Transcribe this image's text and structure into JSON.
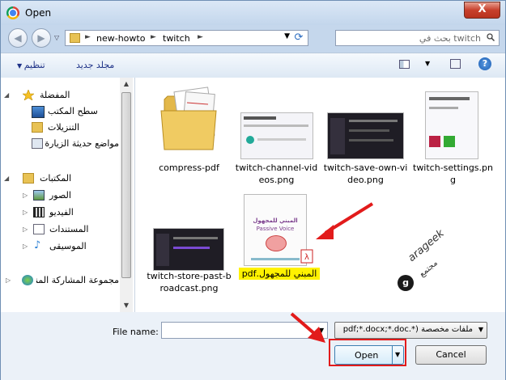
{
  "window": {
    "title": "Open",
    "close_glyph": "X"
  },
  "address": {
    "crumbs": [
      "new-howto",
      "twitch"
    ],
    "sep_glyph": "►",
    "search_placeholder": "twitch بحث في"
  },
  "toolbar": {
    "organize_label": "تنظيم",
    "new_folder_label": "مجلد جديد"
  },
  "sidebar": {
    "favorites_header": "المفضلة",
    "favorites": [
      "سطح المكتب",
      "التنزيلات",
      "مواضع حديثة الزيارة"
    ],
    "libraries_header": "المكتبات",
    "libraries": [
      "الصور",
      "الفيديو",
      "المستندات",
      "الموسيقى"
    ],
    "homegroup": "مجموعة المشاركة المنزلية"
  },
  "files": [
    {
      "name": "compress-pdf",
      "kind": "folder"
    },
    {
      "name": "twitch-channel-videos.png",
      "kind": "png-light"
    },
    {
      "name": "twitch-save-own-video.png",
      "kind": "png-dark"
    },
    {
      "name": "twitch-settings.png",
      "kind": "png-light-tall"
    },
    {
      "name": "twitch-store-past-broadcast.png",
      "kind": "png-dark"
    },
    {
      "name": "المبني للمجهول.pdf",
      "kind": "pdf",
      "selected": true
    }
  ],
  "pdf_cover": {
    "title": "المبني للمجهول",
    "subtitle": "Passive Voice"
  },
  "footer": {
    "filename_label": "File name:",
    "filename_value": "",
    "type_value": "ملفات مخصصة (*.pdf;*.docx;*.doc",
    "open_label": "Open",
    "cancel_label": "Cancel"
  },
  "watermark": {
    "brand": "arageek",
    "tagline": "مجتمع"
  },
  "colors": {
    "highlight_red": "#e21b1b",
    "selection": "#fff200",
    "accent_blue": "#1e3287"
  }
}
